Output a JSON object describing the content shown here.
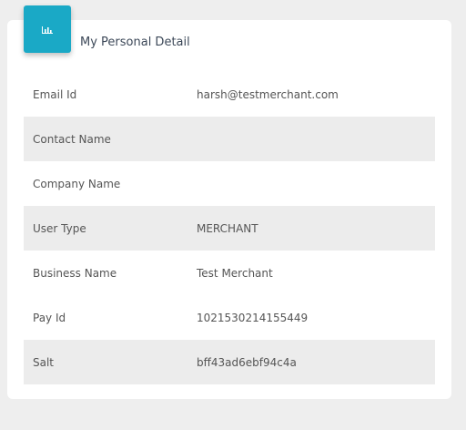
{
  "card": {
    "title": "My Personal Detail",
    "icon": "bar-chart-icon",
    "accent_color": "#1aa9c6"
  },
  "details": [
    {
      "label": "Email Id",
      "value": "harsh@testmerchant.com"
    },
    {
      "label": "Contact Name",
      "value": ""
    },
    {
      "label": "Company Name",
      "value": ""
    },
    {
      "label": "User Type",
      "value": "MERCHANT"
    },
    {
      "label": "Business Name",
      "value": "Test Merchant"
    },
    {
      "label": "Pay Id",
      "value": "1021530214155449"
    },
    {
      "label": "Salt",
      "value": "bff43ad6ebf94c4a"
    }
  ]
}
